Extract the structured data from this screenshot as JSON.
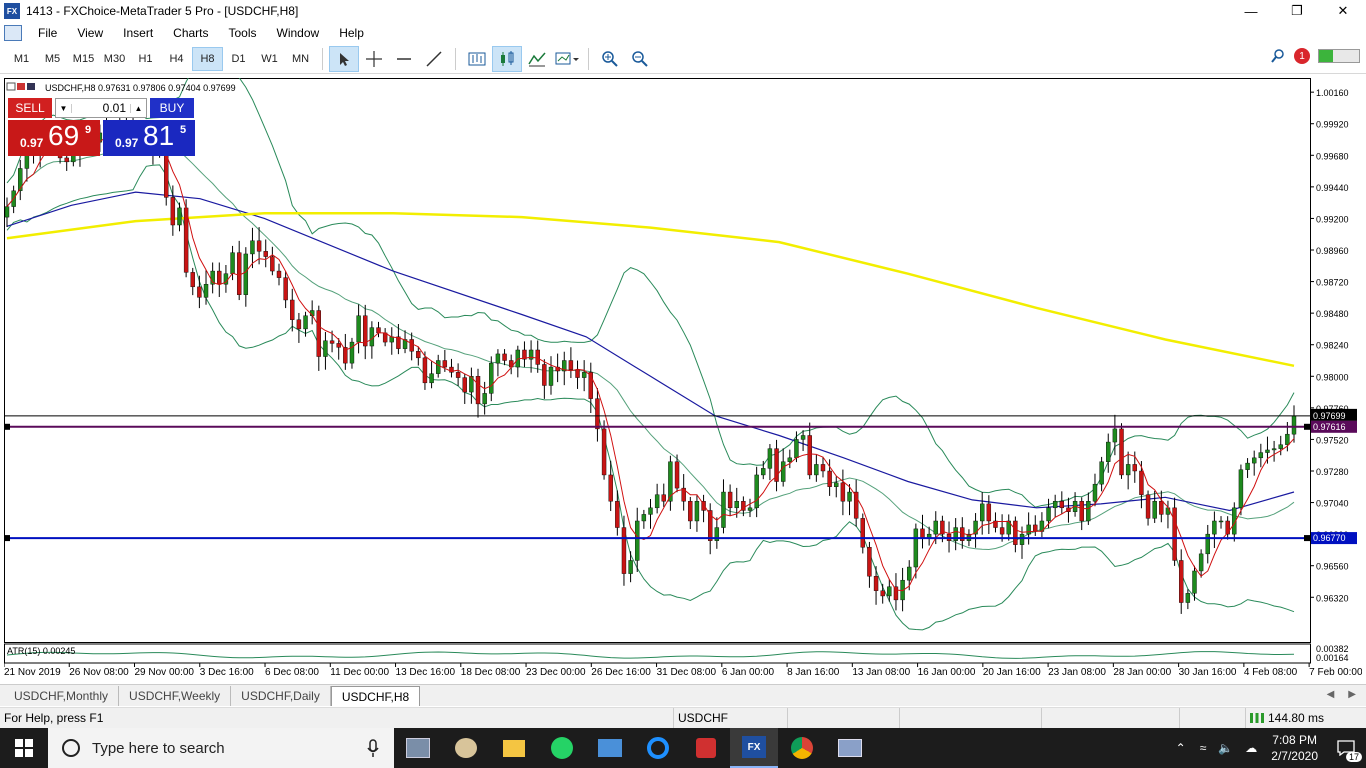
{
  "window": {
    "title": "1413 - FXChoice-MetaTrader 5 Pro - [USDCHF,H8]",
    "app_icon_text": "FX"
  },
  "menu": [
    "File",
    "View",
    "Insert",
    "Charts",
    "Tools",
    "Window",
    "Help"
  ],
  "timeframes": [
    {
      "label": "M1",
      "active": false
    },
    {
      "label": "M5",
      "active": false
    },
    {
      "label": "M15",
      "active": false
    },
    {
      "label": "M30",
      "active": false
    },
    {
      "label": "H1",
      "active": false
    },
    {
      "label": "H4",
      "active": false
    },
    {
      "label": "H8",
      "active": true
    },
    {
      "label": "D1",
      "active": false
    },
    {
      "label": "W1",
      "active": false
    },
    {
      "label": "MN",
      "active": false
    }
  ],
  "toolbar": {
    "notification_count": "1"
  },
  "trade_panel": {
    "sell_label": "SELL",
    "buy_label": "BUY",
    "volume": "0.01",
    "sell_price_prefix": "0.97",
    "sell_price_big": "69",
    "sell_price_sup": "9",
    "buy_price_prefix": "0.97",
    "buy_price_big": "81",
    "buy_price_sup": "5"
  },
  "colors": {
    "bull": "#1e8a1e",
    "bear": "#c81414",
    "ma_yellow": "#f2ee00",
    "ma_blue": "#1a1aa0",
    "ma_red": "#d01010",
    "bands": "#2a8a5a",
    "hline_purple": "#5a0a5a",
    "hline_blue": "#0010c0"
  },
  "chart_data": {
    "type": "candlestick",
    "symbol_header": "USDCHF,H8  0.97631 0.97806 0.97404 0.97699",
    "indicator_label": "ATR(15) 0.00245",
    "ylim": [
      0.9598,
      1.0026
    ],
    "y_ticks": [
      "1.00160",
      "0.99920",
      "0.99680",
      "0.99440",
      "0.99200",
      "0.98960",
      "0.98720",
      "0.98480",
      "0.98240",
      "0.98000",
      "0.97760",
      "0.97520",
      "0.97280",
      "0.97040",
      "0.96800",
      "0.96560",
      "0.96320"
    ],
    "atr_ticks": [
      "0.00382",
      "0.00164"
    ],
    "x_labels": [
      "21 Nov 2019",
      "26 Nov 08:00",
      "29 Nov 00:00",
      "3 Dec 16:00",
      "6 Dec 08:00",
      "11 Dec 00:00",
      "13 Dec 16:00",
      "18 Dec 08:00",
      "23 Dec 00:00",
      "26 Dec 16:00",
      "31 Dec 08:00",
      "6 Jan 00:00",
      "8 Jan 16:00",
      "13 Jan 08:00",
      "16 Jan 00:00",
      "20 Jan 16:00",
      "23 Jan 08:00",
      "28 Jan 00:00",
      "30 Jan 16:00",
      "4 Feb 08:00",
      "7 Feb 00:00"
    ],
    "bid_line": {
      "value": 0.97699,
      "label": "0.97699"
    },
    "hlines": [
      {
        "value": 0.97616,
        "label": "0.97616",
        "color": "purple"
      },
      {
        "value": 0.9677,
        "label": "0.96770",
        "color": "blue"
      }
    ],
    "closes": [
      0.9929,
      0.9941,
      0.9958,
      0.9972,
      0.9968,
      0.9979,
      0.9981,
      0.9976,
      0.9966,
      0.9963,
      0.997,
      0.9976,
      0.9983,
      0.9978,
      0.9985,
      0.9988,
      0.9983,
      0.999,
      0.9993,
      0.9987,
      0.9981,
      0.9978,
      0.9971,
      0.9978,
      0.9936,
      0.9915,
      0.9928,
      0.9879,
      0.9868,
      0.986,
      0.987,
      0.988,
      0.987,
      0.9878,
      0.9894,
      0.9862,
      0.9893,
      0.9903,
      0.9895,
      0.9891,
      0.988,
      0.9875,
      0.9858,
      0.9843,
      0.9836,
      0.9846,
      0.985,
      0.9815,
      0.9827,
      0.9825,
      0.9822,
      0.981,
      0.9826,
      0.9846,
      0.9823,
      0.9837,
      0.9833,
      0.9826,
      0.983,
      0.9821,
      0.9828,
      0.9819,
      0.9814,
      0.9795,
      0.9802,
      0.9812,
      0.9807,
      0.9803,
      0.9799,
      0.9788,
      0.98,
      0.9779,
      0.9787,
      0.981,
      0.9817,
      0.9812,
      0.9807,
      0.982,
      0.9813,
      0.982,
      0.9809,
      0.9793,
      0.9807,
      0.9804,
      0.9812,
      0.9805,
      0.9799,
      0.9803,
      0.9783,
      0.976,
      0.9725,
      0.9705,
      0.9685,
      0.965,
      0.966,
      0.969,
      0.9695,
      0.97,
      0.971,
      0.9705,
      0.9735,
      0.9715,
      0.9705,
      0.969,
      0.9705,
      0.9698,
      0.9675,
      0.9685,
      0.9712,
      0.97,
      0.9705,
      0.9698,
      0.97,
      0.9725,
      0.973,
      0.9745,
      0.972,
      0.9735,
      0.9738,
      0.9752,
      0.9755,
      0.9725,
      0.9733,
      0.9728,
      0.9716,
      0.9719,
      0.9705,
      0.9712,
      0.9692,
      0.967,
      0.9648,
      0.9637,
      0.9633,
      0.964,
      0.963,
      0.9645,
      0.9655,
      0.9684,
      0.9677,
      0.968,
      0.969,
      0.968,
      0.9675,
      0.9685,
      0.9675,
      0.968,
      0.969,
      0.9703,
      0.969,
      0.9685,
      0.968,
      0.969,
      0.9672,
      0.968,
      0.9687,
      0.9682,
      0.969,
      0.97,
      0.9705,
      0.97,
      0.9697,
      0.9705,
      0.969,
      0.9705,
      0.9718,
      0.9735,
      0.975,
      0.976,
      0.9725,
      0.9733,
      0.9728,
      0.971,
      0.9692,
      0.9705,
      0.9695,
      0.97,
      0.966,
      0.9628,
      0.9635,
      0.9652,
      0.9665,
      0.968,
      0.969,
      0.969,
      0.968,
      0.97,
      0.9729,
      0.9734,
      0.9738,
      0.9742,
      0.9744,
      0.9745,
      0.9748,
      0.9756,
      0.977
    ],
    "ma_yellow": [
      [
        0,
        0.9905
      ],
      [
        0.1,
        0.9918
      ],
      [
        0.2,
        0.9924
      ],
      [
        0.3,
        0.9924
      ],
      [
        0.4,
        0.9921
      ],
      [
        0.5,
        0.9913
      ],
      [
        0.6,
        0.9902
      ],
      [
        0.7,
        0.9878
      ],
      [
        0.8,
        0.9852
      ],
      [
        0.9,
        0.9828
      ],
      [
        1.0,
        0.9808
      ]
    ],
    "ma_blue": [
      [
        0,
        0.9914
      ],
      [
        0.05,
        0.993
      ],
      [
        0.1,
        0.994
      ],
      [
        0.15,
        0.9935
      ],
      [
        0.2,
        0.992
      ],
      [
        0.3,
        0.988
      ],
      [
        0.4,
        0.9847
      ],
      [
        0.45,
        0.983
      ],
      [
        0.5,
        0.98
      ],
      [
        0.55,
        0.977
      ],
      [
        0.6,
        0.9755
      ],
      [
        0.65,
        0.9738
      ],
      [
        0.7,
        0.972
      ],
      [
        0.75,
        0.9706
      ],
      [
        0.8,
        0.97
      ],
      [
        0.85,
        0.9703
      ],
      [
        0.9,
        0.9708
      ],
      [
        0.95,
        0.9698
      ],
      [
        1.0,
        0.9712
      ]
    ]
  },
  "tabs": [
    "USDCHF,Monthly",
    "USDCHF,Weekly",
    "USDCHF,Daily",
    "USDCHF,H8"
  ],
  "active_tab": "USDCHF,H8",
  "status": {
    "help": "For Help, press F1",
    "symbol": "USDCHF",
    "ping": "144.80 ms"
  },
  "taskbar": {
    "search_placeholder": "Type here to search",
    "time": "7:08 PM",
    "date": "2/7/2020",
    "notif_count": "17"
  }
}
